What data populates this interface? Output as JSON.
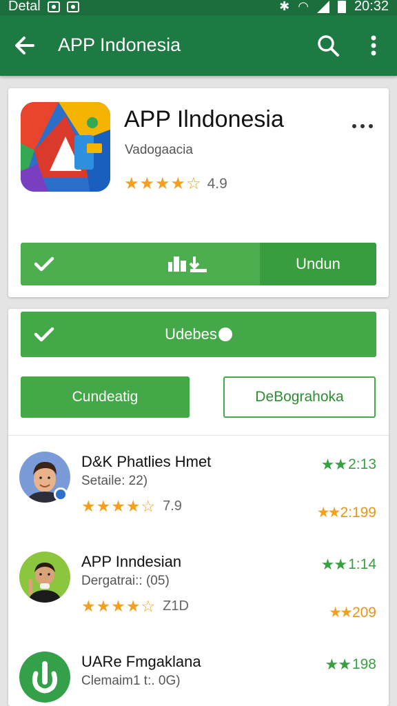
{
  "status_bar": {
    "left_text": "Detal",
    "time": "20:32",
    "icons": [
      "image-icon",
      "photo-icon",
      "bluetooth-icon",
      "wifi-icon",
      "signal-icon",
      "battery-icon"
    ]
  },
  "app_bar": {
    "title": "APP Indonesia",
    "icons": [
      "back-arrow-icon",
      "search-icon",
      "more-vert-icon"
    ]
  },
  "app_card": {
    "name": "APP Ilndonesia",
    "developer": "Vadogaacia",
    "stars": "★★★★☆",
    "rating": "4.9",
    "action_label": "Undun",
    "icons": [
      "app-logo-icon",
      "more-horiz-icon",
      "check-icon",
      "bars-icon"
    ]
  },
  "actions": {
    "update_label": "Udebes",
    "primary_label": "Cundeatig",
    "secondary_label": "DeBograhoka"
  },
  "list": [
    {
      "title": "D&K Phatlies Hmet",
      "subtitle": "Setaile: 22)",
      "stars": "★★★★☆",
      "rating": "7.9",
      "top_stars": "★★",
      "top_value": "2:13",
      "bottom_stars": "★★",
      "bottom_value": "2:199",
      "avatar": "person-avatar"
    },
    {
      "title": "APP Inndesian",
      "subtitle": "Dergatrai:: (05)",
      "stars": "★★★★☆",
      "rating": "Z1D",
      "top_stars": "★★",
      "top_value": "1:14",
      "bottom_stars": "★★",
      "bottom_value": "209",
      "avatar": "person-avatar"
    },
    {
      "title": "UARe Fmgaklana",
      "subtitle": "Clemaim1 t:. 0G)",
      "stars": "",
      "rating": "",
      "top_stars": "★★",
      "top_value": "198",
      "bottom_stars": "",
      "bottom_value": "",
      "avatar": "power-icon"
    }
  ],
  "colors": {
    "status_bar": "#1c6f3d",
    "app_bar": "#1e7a43",
    "accent_green": "#45a848",
    "dark_green": "#399d3f",
    "star_orange": "#f2a01f",
    "star_green": "#38a043"
  }
}
